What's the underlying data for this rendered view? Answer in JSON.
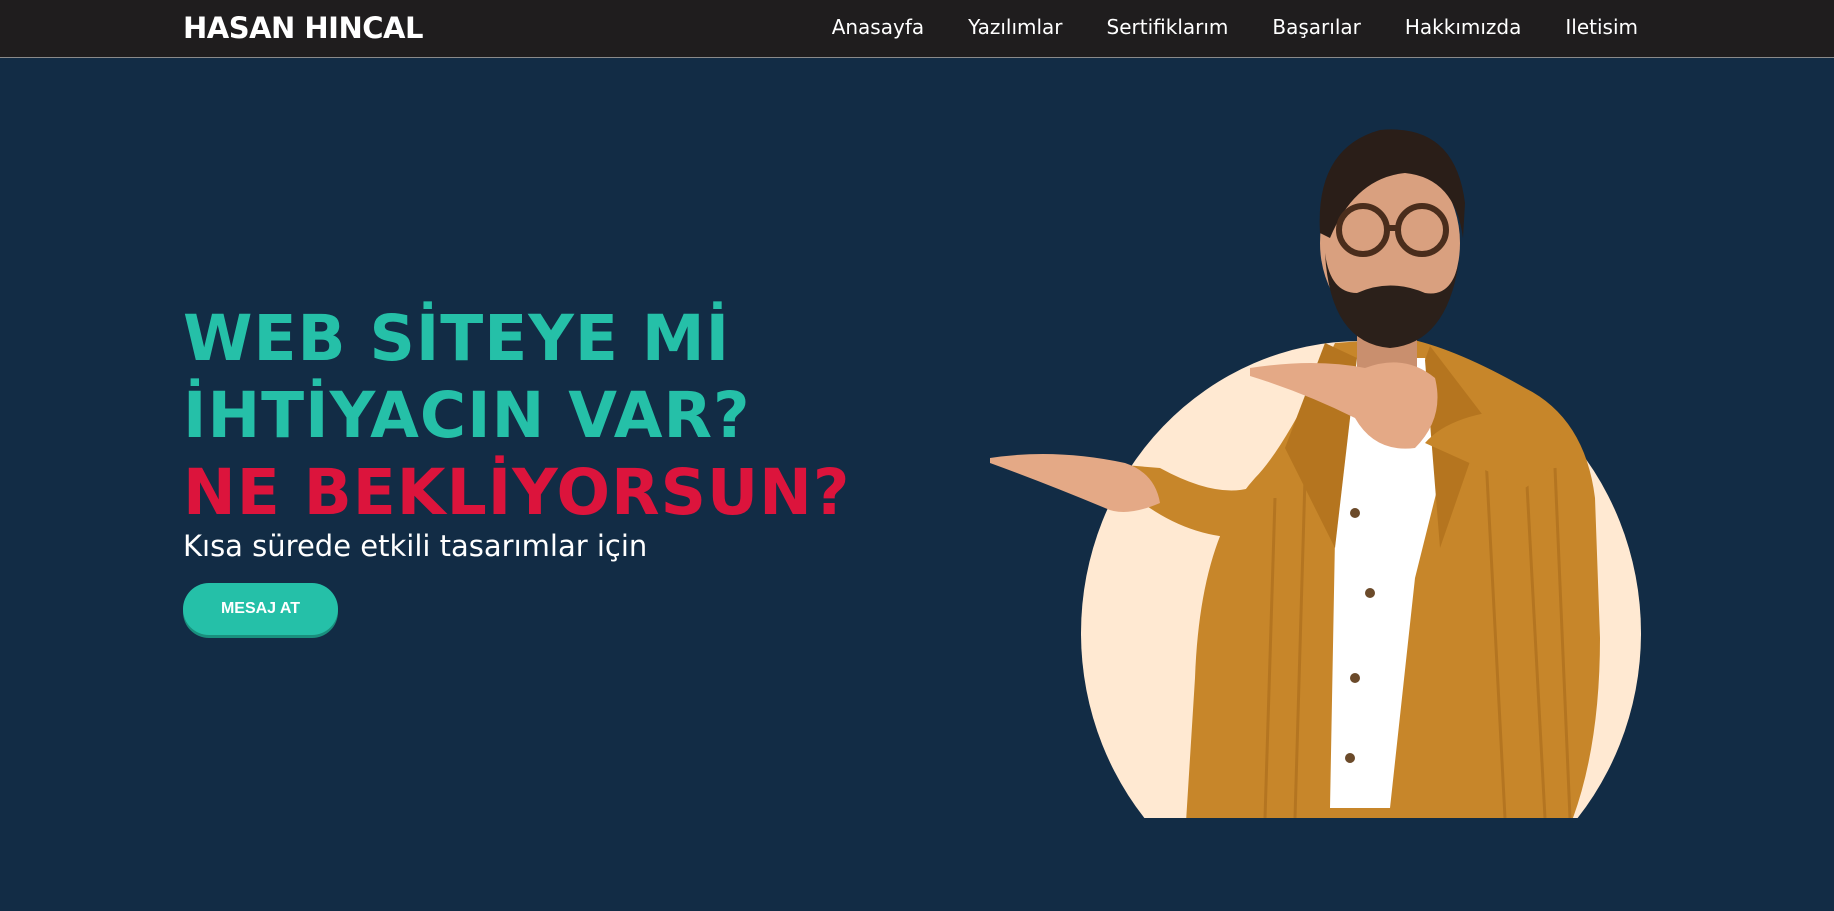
{
  "brand": "HASAN HINCAL",
  "nav": [
    "Anasayfa",
    "Yazılımlar",
    "Sertifiklarım",
    "Başarılar",
    "Hakkımızda",
    "Iletisim"
  ],
  "hero": {
    "line1": "WEB SİTEYE Mİ",
    "line2": "İHTİYACIN VAR?",
    "line3": "NE BEKLİYORSUN?",
    "subtitle": "Kısa sürede etkili tasarımlar için",
    "cta": "MESAJ AT"
  },
  "colors": {
    "background": "#122c45",
    "navbar": "#1f1d1e",
    "accent_teal": "#25c0a8",
    "accent_red": "#dc143c",
    "circle": "#ffe9d2",
    "jacket": "#c7862a"
  }
}
